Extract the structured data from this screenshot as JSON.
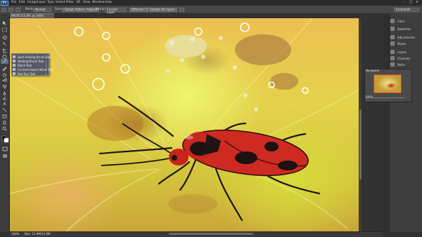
{
  "app": {
    "logo": "Ps"
  },
  "menu": [
    "File",
    "Edit",
    "Image",
    "Layer",
    "Type",
    "Select",
    "Filter",
    "3D",
    "View",
    "Window",
    "Help"
  ],
  "workspace": "Essentials",
  "options": {
    "mode_label": "Mode:",
    "mode_value": "Normal",
    "source_label": "Source:",
    "sampled_label": "Sampled",
    "pattern_label": "Pattern",
    "aligned_label": "Aligned",
    "sample_label": "Sample:",
    "sample_value": "Current Layer",
    "diffusion_label": "Diffusion: 5",
    "sample_all_label": "Sample All Layers"
  },
  "document": {
    "tab_title": "IMGP5714.JPG @ 100% (RGB/8*)"
  },
  "flyout": {
    "items": [
      {
        "label": "Spot Healing Brush Tool",
        "key": "J"
      },
      {
        "label": "Healing Brush Tool",
        "key": "J"
      },
      {
        "label": "Patch Tool",
        "key": "J"
      },
      {
        "label": "Content-Aware Move Tool",
        "key": "J"
      },
      {
        "label": "Red Eye Tool",
        "key": "J"
      }
    ]
  },
  "right_panel": {
    "items": [
      {
        "icon": "color-icon",
        "label": "Color"
      },
      {
        "icon": "swatches-icon",
        "label": "Swatches"
      },
      {
        "icon": "adjustments-icon",
        "label": "Adjustments"
      },
      {
        "icon": "styles-icon",
        "label": "Styles"
      },
      {
        "icon": "layers-icon",
        "label": "Layers"
      },
      {
        "icon": "channels-icon",
        "label": "Channels"
      },
      {
        "icon": "paths-icon",
        "label": "Paths"
      }
    ]
  },
  "navigator": {
    "title": "Navigator",
    "zoom": "100%"
  },
  "status": {
    "zoom": "100%",
    "doc": "Doc: 12.9M/12.9M"
  },
  "colors": {
    "accent": "#63a7ff",
    "bug_red": "#cf2a22",
    "flower_yellow": "#e8d84c"
  }
}
